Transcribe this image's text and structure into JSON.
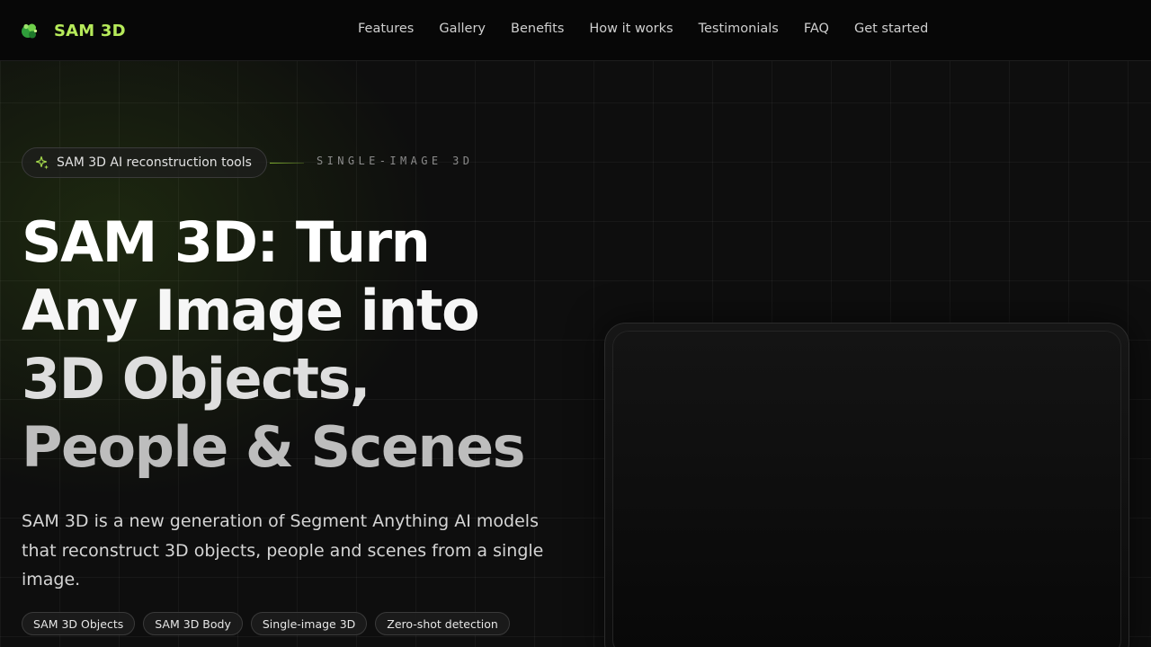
{
  "header": {
    "brand": "SAM 3D",
    "nav": [
      "Features",
      "Gallery",
      "Benefits",
      "How it works",
      "Testimonials",
      "FAQ",
      "Get started"
    ]
  },
  "hero": {
    "badge": "SAM 3D AI reconstruction tools",
    "tagline": "SINGLE-IMAGE 3D",
    "headline": {
      "line1": "SAM 3D: Turn",
      "line2": "Any Image into",
      "line3": "3D Objects,",
      "line4": "People & Scenes"
    },
    "subtitle": "SAM 3D is a new generation of Segment Anything AI models that reconstruct 3D objects, people and scenes from a single image.",
    "chips": [
      "SAM 3D Objects",
      "SAM 3D Body",
      "Single-image 3D",
      "Zero-shot detection"
    ]
  },
  "colors": {
    "accent": "#b6ea5a",
    "background": "#0e0e0e"
  },
  "icons": {
    "brand": "brand-logo-icon",
    "badge": "sparkle-icon"
  }
}
